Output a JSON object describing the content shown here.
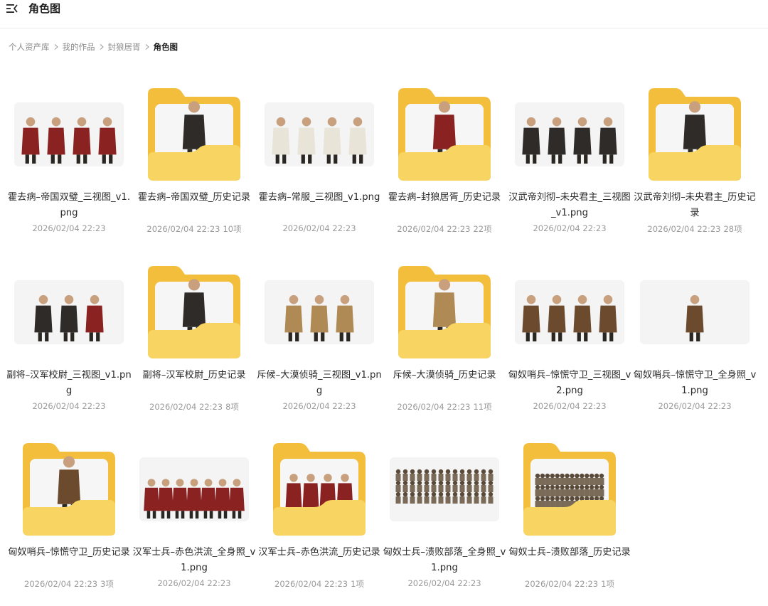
{
  "header": {
    "title": "角色图",
    "menu_icon": "menu-collapse-icon"
  },
  "breadcrumb": {
    "items": [
      "个人资产库",
      "我的作品",
      "封狼居胥"
    ],
    "current": "角色图",
    "separator_icon": "chevron-right-icon"
  },
  "colors": {
    "folder_back": "#F2BE3C",
    "folder_front": "#F8D463",
    "text_meta": "#9A9A9A",
    "figure_red": "#8A2222",
    "figure_brown": "#6B4A2E",
    "figure_dark": "#2E2B28"
  },
  "items": [
    {
      "kind": "image",
      "name": "霍去病–帝国双璧_三视图_v1.png",
      "date": "2026/02/04 22:23",
      "count": "",
      "figures": [
        "red",
        "red",
        "red",
        "red"
      ]
    },
    {
      "kind": "folder",
      "name": "霍去病–帝国双璧_历史记录",
      "date": "2026/02/04 22:23",
      "count": "10项",
      "figures": [
        "dark"
      ]
    },
    {
      "kind": "image",
      "name": "霍去病–常服_三视图_v1.png",
      "date": "2026/02/04 22:23",
      "count": "",
      "figures": [
        "white",
        "white",
        "white",
        "white"
      ]
    },
    {
      "kind": "folder",
      "name": "霍去病–封狼居胥_历史记录",
      "date": "2026/02/04 22:23",
      "count": "22项",
      "figures": [
        "red"
      ]
    },
    {
      "kind": "image",
      "name": "汉武帝刘彻–未央君主_三视图_v1.png",
      "date": "2026/02/04 22:23",
      "count": "",
      "figures": [
        "dark",
        "dark",
        "dark",
        "dark"
      ]
    },
    {
      "kind": "folder",
      "name": "汉武帝刘彻–未央君主_历史记录",
      "date": "2026/02/04 22:23",
      "count": "28项",
      "figures": [
        "dark"
      ]
    },
    {
      "kind": "image",
      "name": "副将–汉军校尉_三视图_v1.png",
      "date": "2026/02/04 22:23",
      "count": "",
      "figures": [
        "dark",
        "dark",
        "red"
      ]
    },
    {
      "kind": "folder",
      "name": "副将–汉军校尉_历史记录",
      "date": "2026/02/04 22:23",
      "count": "8项",
      "figures": [
        "dark"
      ]
    },
    {
      "kind": "image",
      "name": "斥候–大漠侦骑_三视图_v1.png",
      "date": "2026/02/04 22:23",
      "count": "",
      "figures": [
        "tan",
        "tan",
        "tan"
      ]
    },
    {
      "kind": "folder",
      "name": "斥候–大漠侦骑_历史记录",
      "date": "2026/02/04 22:23",
      "count": "11项",
      "figures": [
        "tan"
      ]
    },
    {
      "kind": "image",
      "name": "匈奴哨兵–惊慌守卫_三视图_v2.png",
      "date": "2026/02/04 22:23",
      "count": "",
      "figures": [
        "brown",
        "brown",
        "brown",
        "brown"
      ]
    },
    {
      "kind": "image",
      "name": "匈奴哨兵–惊慌守卫_全身照_v1.png",
      "date": "2026/02/04 22:23",
      "count": "",
      "figures": [
        "brown"
      ]
    },
    {
      "kind": "folder",
      "name": "匈奴哨兵–惊慌守卫_历史记录",
      "date": "2026/02/04 22:23",
      "count": "3项",
      "figures": [
        "brown"
      ]
    },
    {
      "kind": "image",
      "name": "汉军士兵–赤色洪流_全身照_v1.png",
      "date": "2026/02/04 22:23",
      "count": "",
      "figures": [
        "red",
        "red",
        "red",
        "red",
        "red",
        "red",
        "red"
      ]
    },
    {
      "kind": "folder",
      "name": "汉军士兵–赤色洪流_历史记录",
      "date": "2026/02/04 22:23",
      "count": "1项",
      "figures": [
        "red",
        "red",
        "red",
        "red"
      ]
    },
    {
      "kind": "image",
      "name": "匈奴士兵–溃败部落_全身照_v1.png",
      "date": "2026/02/04 22:23",
      "count": "",
      "figures": [
        "crowd"
      ]
    },
    {
      "kind": "folder",
      "name": "匈奴士兵–溃败部落_历史记录",
      "date": "2026/02/04 22:23",
      "count": "1项",
      "figures": [
        "crowd"
      ]
    }
  ]
}
